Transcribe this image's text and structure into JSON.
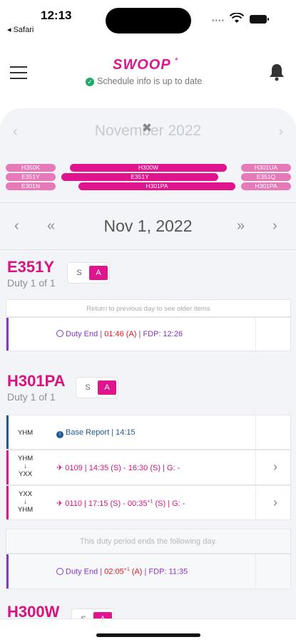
{
  "status": {
    "time": "12:13",
    "back": "◂ Safari",
    "dots": "••••"
  },
  "header": {
    "logo": "SWOOP",
    "logo_star": "*",
    "schedule": "Schedule info is up to date"
  },
  "month": {
    "title": "November 2022",
    "prev": "‹",
    "next": "›",
    "close": "✖"
  },
  "pills": [
    "H350K",
    "E351Y",
    "E301N",
    "H300W",
    "E351Y",
    "H301PA",
    "H301UA",
    "E351Q",
    "H301PA"
  ],
  "day": {
    "title": "Nov 1, 2022",
    "prev": "‹",
    "prev_fast": "«",
    "next_fast": "»",
    "next": "›"
  },
  "duty1": {
    "id": "E351Y",
    "sub": "Duty 1 of 1",
    "s": "S",
    "a": "A",
    "note": "Return to previous day to see older items",
    "end_label": "Duty End | ",
    "end_time": "01:46 (A)",
    "end_fdp": " | FDP: 12:26"
  },
  "duty2": {
    "id": "H301PA",
    "sub": "Duty 1 of 1",
    "s": "S",
    "a": "A",
    "base": {
      "loc": "YHM",
      "label": "Base Report | 14:15"
    },
    "flights": [
      {
        "from": "YHM",
        "arrow": "↓",
        "to": "YXX",
        "text": "0109 | 14:35 (S) - 16:30 (S) | G: -"
      },
      {
        "from": "YXX",
        "arrow": "↓",
        "to": "YHM",
        "text": "0110 | 17:15 (S) - 00:35",
        "sup": "+1",
        "text2": " (S) | G: -"
      }
    ],
    "note": "This duty period ends the following day.",
    "end_label": "Duty End | ",
    "end_time": "02:05",
    "end_sup": "+1",
    "end_time2": " (A)",
    "end_fdp": " | FDP: 11:35"
  },
  "duty3": {
    "id": "H300W",
    "s": "S",
    "a": "A"
  },
  "colors": {
    "accent": "#e0158e",
    "red": "#e0181d",
    "purple": "#8a35c9",
    "blue": "#1e5a94"
  }
}
